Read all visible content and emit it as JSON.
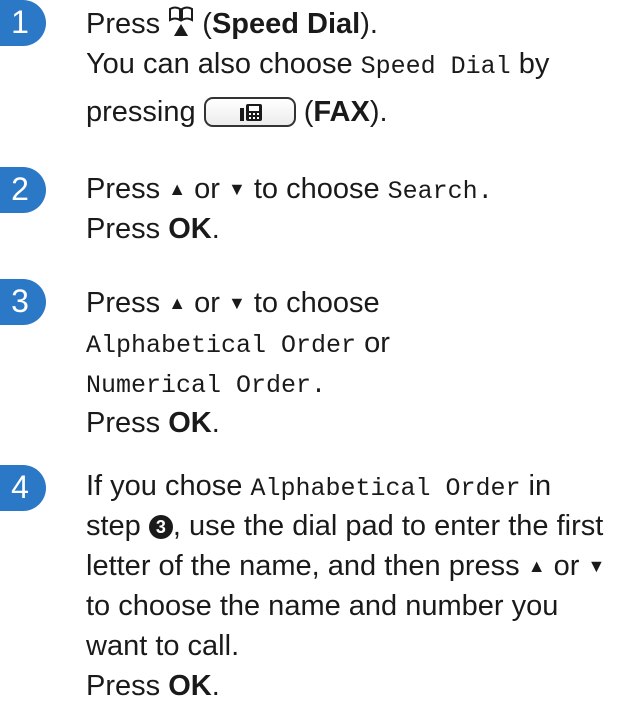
{
  "steps": [
    {
      "number": "1",
      "press": "Press",
      "speed_dial_open": "(",
      "speed_dial_label": "Speed Dial",
      "speed_dial_close": ").",
      "line2_prefix": "You can also choose",
      "line2_mono": "Speed Dial",
      "line2_suffix": "by",
      "line3_prefix": "pressing",
      "fax_open": "(",
      "fax_label": "FAX",
      "fax_close": ")."
    },
    {
      "number": "2",
      "press": "Press",
      "up_arrow": "▲",
      "or": "or",
      "down_arrow": "▼",
      "to_choose": "to choose",
      "option": "Search",
      "period": ".",
      "press_ok_prefix": "Press",
      "ok": "OK",
      "press_ok_suffix": "."
    },
    {
      "number": "3",
      "press": "Press",
      "up_arrow": "▲",
      "or": "or",
      "down_arrow": "▼",
      "to_choose": "to choose",
      "option1": "Alphabetical Order",
      "or2": "or",
      "option2": "Numerical Order",
      "period": ".",
      "press_ok_prefix": "Press",
      "ok": "OK",
      "press_ok_suffix": "."
    },
    {
      "number": "4",
      "if_you_chose": "If you chose",
      "option": "Alphabetical Order",
      "in": "in",
      "step_word": "step",
      "step_ref": "3",
      "line2_rest": ", use the dial pad to enter the first",
      "line3_prefix": "letter of the name, and then press",
      "up_arrow": "▲",
      "or": "or",
      "down_arrow": "▼",
      "line4": "to choose the name and number you",
      "line5": "want to call.",
      "press_ok_prefix": "Press",
      "ok": "OK",
      "press_ok_suffix": "."
    }
  ]
}
